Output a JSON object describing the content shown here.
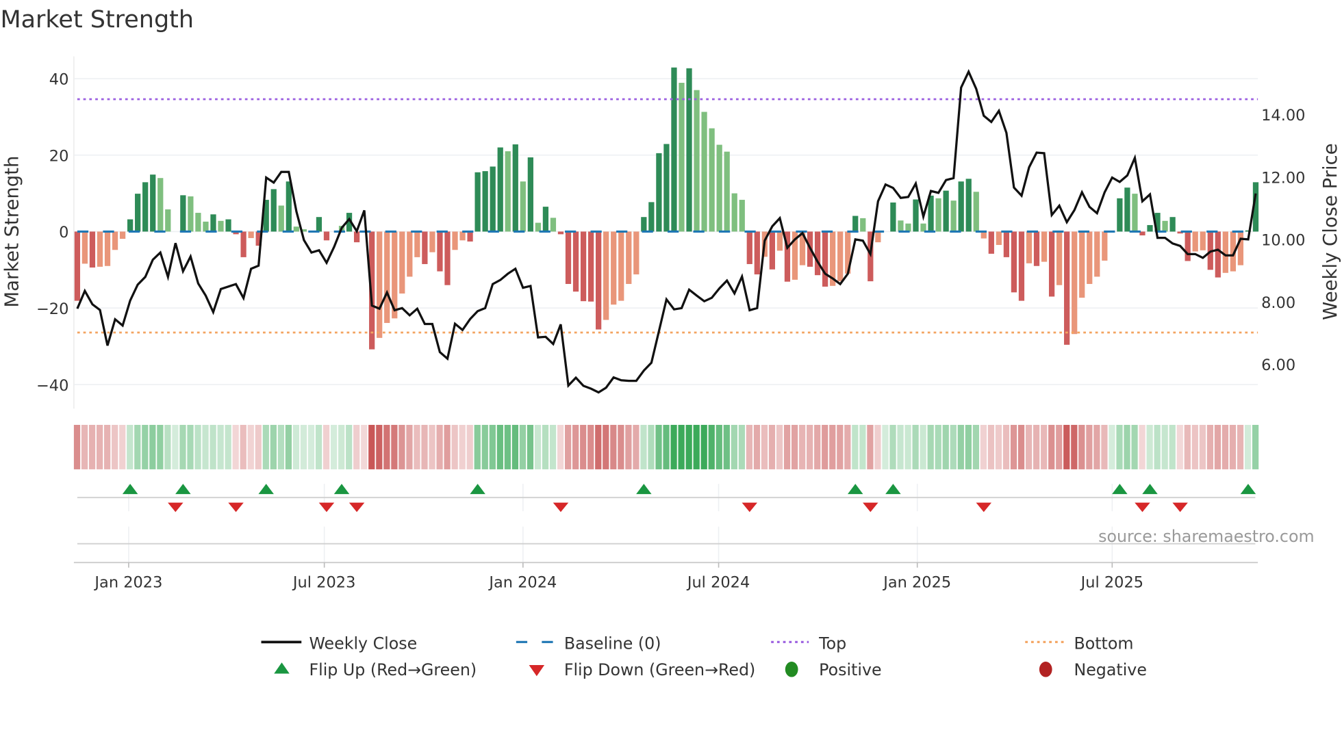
{
  "chart_data": {
    "type": "bar",
    "title": "Market Strength",
    "ylabel": "Market Strength",
    "y2label": "Weekly Close Price",
    "ylim": [
      -46.3,
      45.8
    ],
    "y2lim": [
      4.58,
      15.86
    ],
    "yticks": [
      40,
      20,
      0,
      -20,
      -40
    ],
    "yticklabels": [
      "40",
      "20",
      "0",
      "−20",
      "−40"
    ],
    "y2ticks": [
      14,
      12,
      10,
      8,
      6
    ],
    "y2ticklabels": [
      "14.00",
      "12.00",
      "10.00",
      "8.00",
      "6.00"
    ],
    "xticks": [
      {
        "label": "Jan 2023",
        "week": 6.8
      },
      {
        "label": "Jul 2023",
        "week": 32.7
      },
      {
        "label": "Jan 2024",
        "week": 59.0
      },
      {
        "label": "Jul 2024",
        "week": 84.9
      },
      {
        "label": "Jan 2025",
        "week": 111.2
      },
      {
        "label": "Jul 2025",
        "week": 137.0
      }
    ],
    "top_level": 34.6,
    "bottom_level": -26.4,
    "baseline": 0,
    "strength": [
      -18.1,
      -8.4,
      -9.4,
      -9.2,
      -9,
      -4.8,
      -1.9,
      3.2,
      9.9,
      12.9,
      14.9,
      14,
      5.8,
      0,
      9.5,
      9.2,
      4.9,
      2.6,
      4.5,
      2.8,
      3.2,
      -0.7,
      -6.7,
      -1.7,
      -3.7,
      8.3,
      11.1,
      6.8,
      13.1,
      1.3,
      0.6,
      0,
      3.8,
      -2.3,
      0,
      1.5,
      4.9,
      -2.8,
      -0.3,
      -30.8,
      -27.8,
      -23.9,
      -22.7,
      -16.2,
      -11.8,
      -6.7,
      -8.5,
      -5.4,
      -10.4,
      -14,
      -4.8,
      -2.3,
      -2.6,
      15.5,
      15.8,
      17,
      22,
      21,
      22.8,
      13.1,
      19.4,
      2.3,
      6.5,
      3.6,
      -0.7,
      -13.7,
      -15.7,
      -18.2,
      -18.3,
      -25.6,
      -23.1,
      -19.1,
      -18.1,
      -13.7,
      -11.2,
      3.8,
      7.7,
      20.5,
      22.9,
      42.9,
      38.9,
      42.7,
      37,
      31.3,
      27,
      22.7,
      20.9,
      10,
      8.3,
      -8.5,
      -11.2,
      -6.6,
      -9.9,
      -5,
      -13.1,
      -12.6,
      -8.8,
      -9.2,
      -11.4,
      -14.4,
      -14.2,
      -13,
      -11,
      4.1,
      3.5,
      -13,
      -2.8,
      0,
      7.6,
      2.9,
      2.1,
      8.4,
      2.1,
      9.4,
      8.7,
      10.7,
      8.1,
      13.1,
      13.8,
      10.4,
      -1.8,
      -5.8,
      -3.5,
      -6.7,
      -15.9,
      -18.1,
      -8.3,
      -9,
      -7.9,
      -17,
      -14,
      -29.6,
      -26.8,
      -17.3,
      -13.7,
      -11.8,
      -7.6,
      0,
      8.7,
      11.5,
      9.9,
      -1,
      1.7,
      4.9,
      2.8,
      3.8,
      -0.5,
      -7.7,
      -5.2,
      -4.9,
      -10,
      -12,
      -10.8,
      -10.4,
      -8.8,
      0.3,
      12.9
    ],
    "shade": "dldllllddddllldllldldddldddldlllddllddldlllllldlddlldddddldldldldddddd lllllddddd ldllllllld dldldllddd llldldlldl ldldldlddl ldldddldld ldlllllldd ldddldddll ddllldd",
    "weekly_close": [
      7.78,
      8.35,
      7.92,
      7.74,
      6.6,
      7.44,
      7.24,
      8.04,
      8.55,
      8.8,
      9.35,
      9.58,
      8.8,
      9.88,
      8.98,
      9.45,
      8.59,
      8.2,
      7.67,
      8.41,
      8.49,
      8.57,
      8.12,
      9.06,
      9.16,
      11.98,
      11.82,
      12.16,
      12.16,
      10.9,
      9.98,
      9.58,
      9.65,
      9.25,
      9.76,
      10.37,
      10.65,
      10.26,
      10.93,
      7.88,
      7.78,
      8.3,
      7.73,
      7.8,
      7.57,
      7.78,
      7.29,
      7.29,
      6.39,
      6.18,
      7.3,
      7.1,
      7.45,
      7.7,
      7.8,
      8.57,
      8.7,
      8.9,
      9.06,
      8.45,
      8.51,
      6.86,
      6.88,
      6.65,
      7.28,
      5.32,
      5.57,
      5.31,
      5.22,
      5.1,
      5.25,
      5.58,
      5.49,
      5.47,
      5.47,
      5.8,
      6.05,
      7.06,
      8.08,
      7.76,
      7.8,
      8.39,
      8.2,
      8.02,
      8.13,
      8.43,
      8.68,
      8.27,
      8.81,
      7.73,
      7.8,
      9.96,
      10.42,
      10.68,
      9.73,
      10.0,
      10.2,
      9.73,
      9.29,
      8.9,
      8.75,
      8.57,
      8.9,
      10.0,
      9.96,
      9.53,
      11.22,
      11.76,
      11.65,
      11.33,
      11.36,
      11.79,
      10.73,
      11.55,
      11.49,
      11.9,
      11.96,
      14.86,
      15.37,
      14.82,
      13.96,
      13.76,
      14.12,
      13.41,
      11.66,
      11.4,
      12.31,
      12.78,
      12.76,
      10.78,
      11.08,
      10.55,
      10.94,
      11.51,
      11.04,
      10.84,
      11.51,
      11.98,
      11.84,
      12.05,
      12.61,
      11.22,
      11.44,
      10.05,
      10.05,
      9.87,
      9.79,
      9.53,
      9.53,
      9.41,
      9.61,
      9.67,
      9.49,
      9.49,
      10.02,
      10.0,
      11.47
    ],
    "flip_up_weeks": [
      7,
      14,
      25,
      35,
      53,
      75,
      103,
      108,
      138,
      142,
      155
    ],
    "flip_down_weeks": [
      13,
      21,
      33,
      37,
      64,
      89,
      105,
      120,
      141,
      146
    ],
    "legend": {
      "weekly_close": "Weekly Close",
      "baseline": "Baseline (0)",
      "top": "Top",
      "bottom": "Bottom",
      "flip_up": "Flip Up (Red→Green)",
      "flip_down": "Flip Down (Green→Red)",
      "positive": "Positive",
      "negative": "Negative"
    },
    "legend_position": "bottom-center",
    "source": "source: sharemaestro.com",
    "colors": {
      "pos_dark": "#2e8b57",
      "pos_light": "#7fbf7f",
      "neg_dark": "#cd5c5c",
      "neg_light": "#e9967a",
      "line": "#111111",
      "baseline": "#1f77b4",
      "top": "#9b5fe0",
      "bottom": "#f4a460",
      "flip_up": "#1a9641",
      "flip_down": "#d62728",
      "positive": "#228b22",
      "negative": "#b22222"
    }
  }
}
